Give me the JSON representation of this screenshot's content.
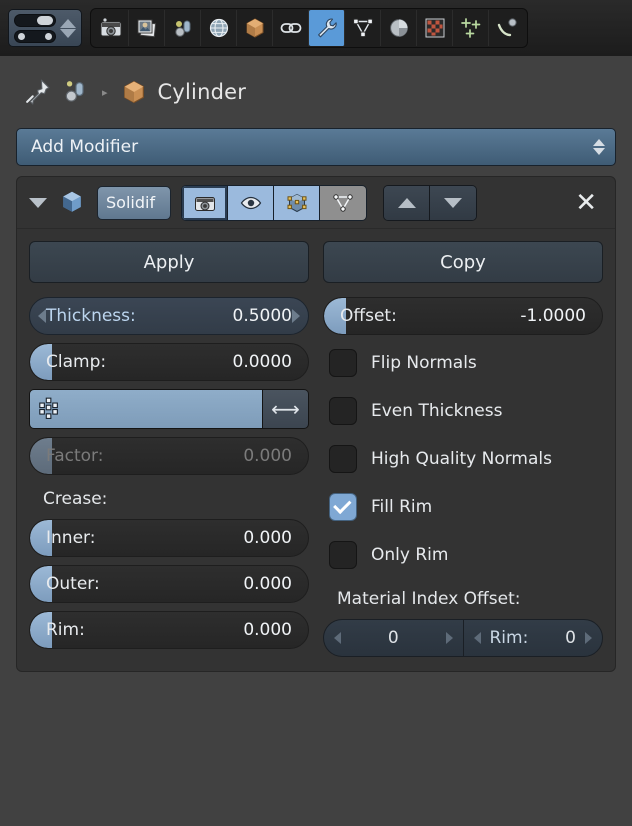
{
  "topbar": {
    "editor_selector": {
      "name": "editor-type-selector"
    },
    "tabs": [
      {
        "id": "render",
        "label": "Render",
        "icon": "camera-icon",
        "active": false
      },
      {
        "id": "scene",
        "label": "Scene",
        "icon": "photos-icon",
        "active": false
      },
      {
        "id": "object-lamp",
        "label": "Object Data",
        "icon": "lamp-icon",
        "active": false
      },
      {
        "id": "world",
        "label": "World",
        "icon": "globe-icon",
        "active": false
      },
      {
        "id": "object",
        "label": "Object",
        "icon": "cube-icon",
        "active": false
      },
      {
        "id": "constraints",
        "label": "Constraints",
        "icon": "chain-link-icon",
        "active": false
      },
      {
        "id": "modifiers",
        "label": "Modifiers",
        "icon": "wrench-icon",
        "active": true
      },
      {
        "id": "data",
        "label": "Object Data",
        "icon": "mesh-triangle-icon",
        "active": false
      },
      {
        "id": "material",
        "label": "Material",
        "icon": "sphere-icon",
        "active": false
      },
      {
        "id": "texture",
        "label": "Texture",
        "icon": "checker-icon",
        "active": false
      },
      {
        "id": "particles",
        "label": "Particles",
        "icon": "sparkles-icon",
        "active": false
      },
      {
        "id": "physics",
        "label": "Physics",
        "icon": "physics-icon",
        "active": false
      }
    ]
  },
  "breadcrumb": {
    "pin_icon": "pin-icon",
    "scene_icon": "scene-object-icon",
    "separator": "▸",
    "object_icon": "cube-icon",
    "object_name": "Cylinder"
  },
  "add_modifier": {
    "label": "Add Modifier"
  },
  "modifier": {
    "expand_icon": "expand-triangle-icon",
    "type_icon": "solidify-modifier-icon",
    "name": "Solidif",
    "toggles": [
      {
        "id": "render",
        "icon": "camera-icon",
        "enabled": true,
        "selected": true
      },
      {
        "id": "viewport",
        "icon": "eye-icon",
        "enabled": true,
        "selected": false
      },
      {
        "id": "editmode",
        "icon": "editmode-icon",
        "enabled": true,
        "selected": false
      },
      {
        "id": "cage",
        "icon": "cage-icon",
        "enabled": false,
        "selected": false
      }
    ],
    "move_up_icon": "move-up-icon",
    "move_down_icon": "move-down-icon",
    "close_icon": "close-icon",
    "apply_label": "Apply",
    "copy_label": "Copy",
    "left_column": {
      "thickness": {
        "label": "Thickness:",
        "value": "0.5000"
      },
      "clamp": {
        "label": "Clamp:",
        "value": "0.0000"
      },
      "vertex_group": {
        "icon": "vertex-group-icon",
        "value": "",
        "invert_icon": "invert-arrows-icon"
      },
      "factor": {
        "label": "Factor:",
        "value": "0.000"
      },
      "crease_label": "Crease:",
      "inner": {
        "label": "Inner:",
        "value": "0.000"
      },
      "outer": {
        "label": "Outer:",
        "value": "0.000"
      },
      "rim": {
        "label": "Rim:",
        "value": "0.000"
      }
    },
    "right_column": {
      "offset": {
        "label": "Offset:",
        "value": "-1.0000"
      },
      "checkboxes": [
        {
          "label": "Flip Normals",
          "checked": false
        },
        {
          "label": "Even Thickness",
          "checked": false
        },
        {
          "label": "High Quality Normals",
          "checked": false
        },
        {
          "label": "Fill Rim",
          "checked": true
        },
        {
          "label": "Only Rim",
          "checked": false
        }
      ],
      "material_index_label": "Material Index Offset:",
      "mat_offset": {
        "value": "0"
      },
      "mat_rim": {
        "label": "Rim:",
        "value": "0"
      }
    }
  },
  "colors": {
    "accent_blue": "#5a9ad8",
    "slider_blue": "#9cb9d6",
    "panel_bg": "#333333",
    "window_bg": "#414141",
    "header_bg": "#1c1c1c"
  }
}
